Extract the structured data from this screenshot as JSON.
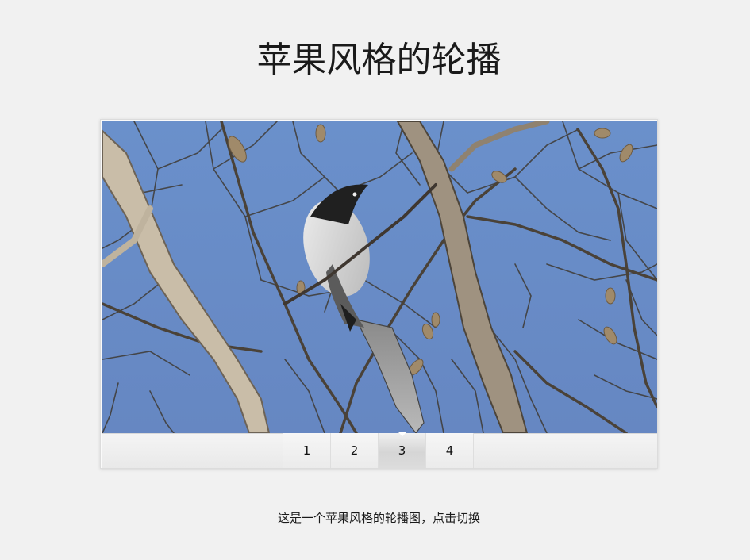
{
  "page": {
    "title": "苹果风格的轮播",
    "caption": "这是一个苹果风格的轮播图，点击切换"
  },
  "carousel": {
    "image": "bird-on-branches",
    "pager": [
      "1",
      "2",
      "3",
      "4"
    ],
    "active_index": 2
  },
  "colors": {
    "background": "#f1f1f1",
    "sky": "#6a8fc8",
    "branch": "#b8a88f"
  }
}
